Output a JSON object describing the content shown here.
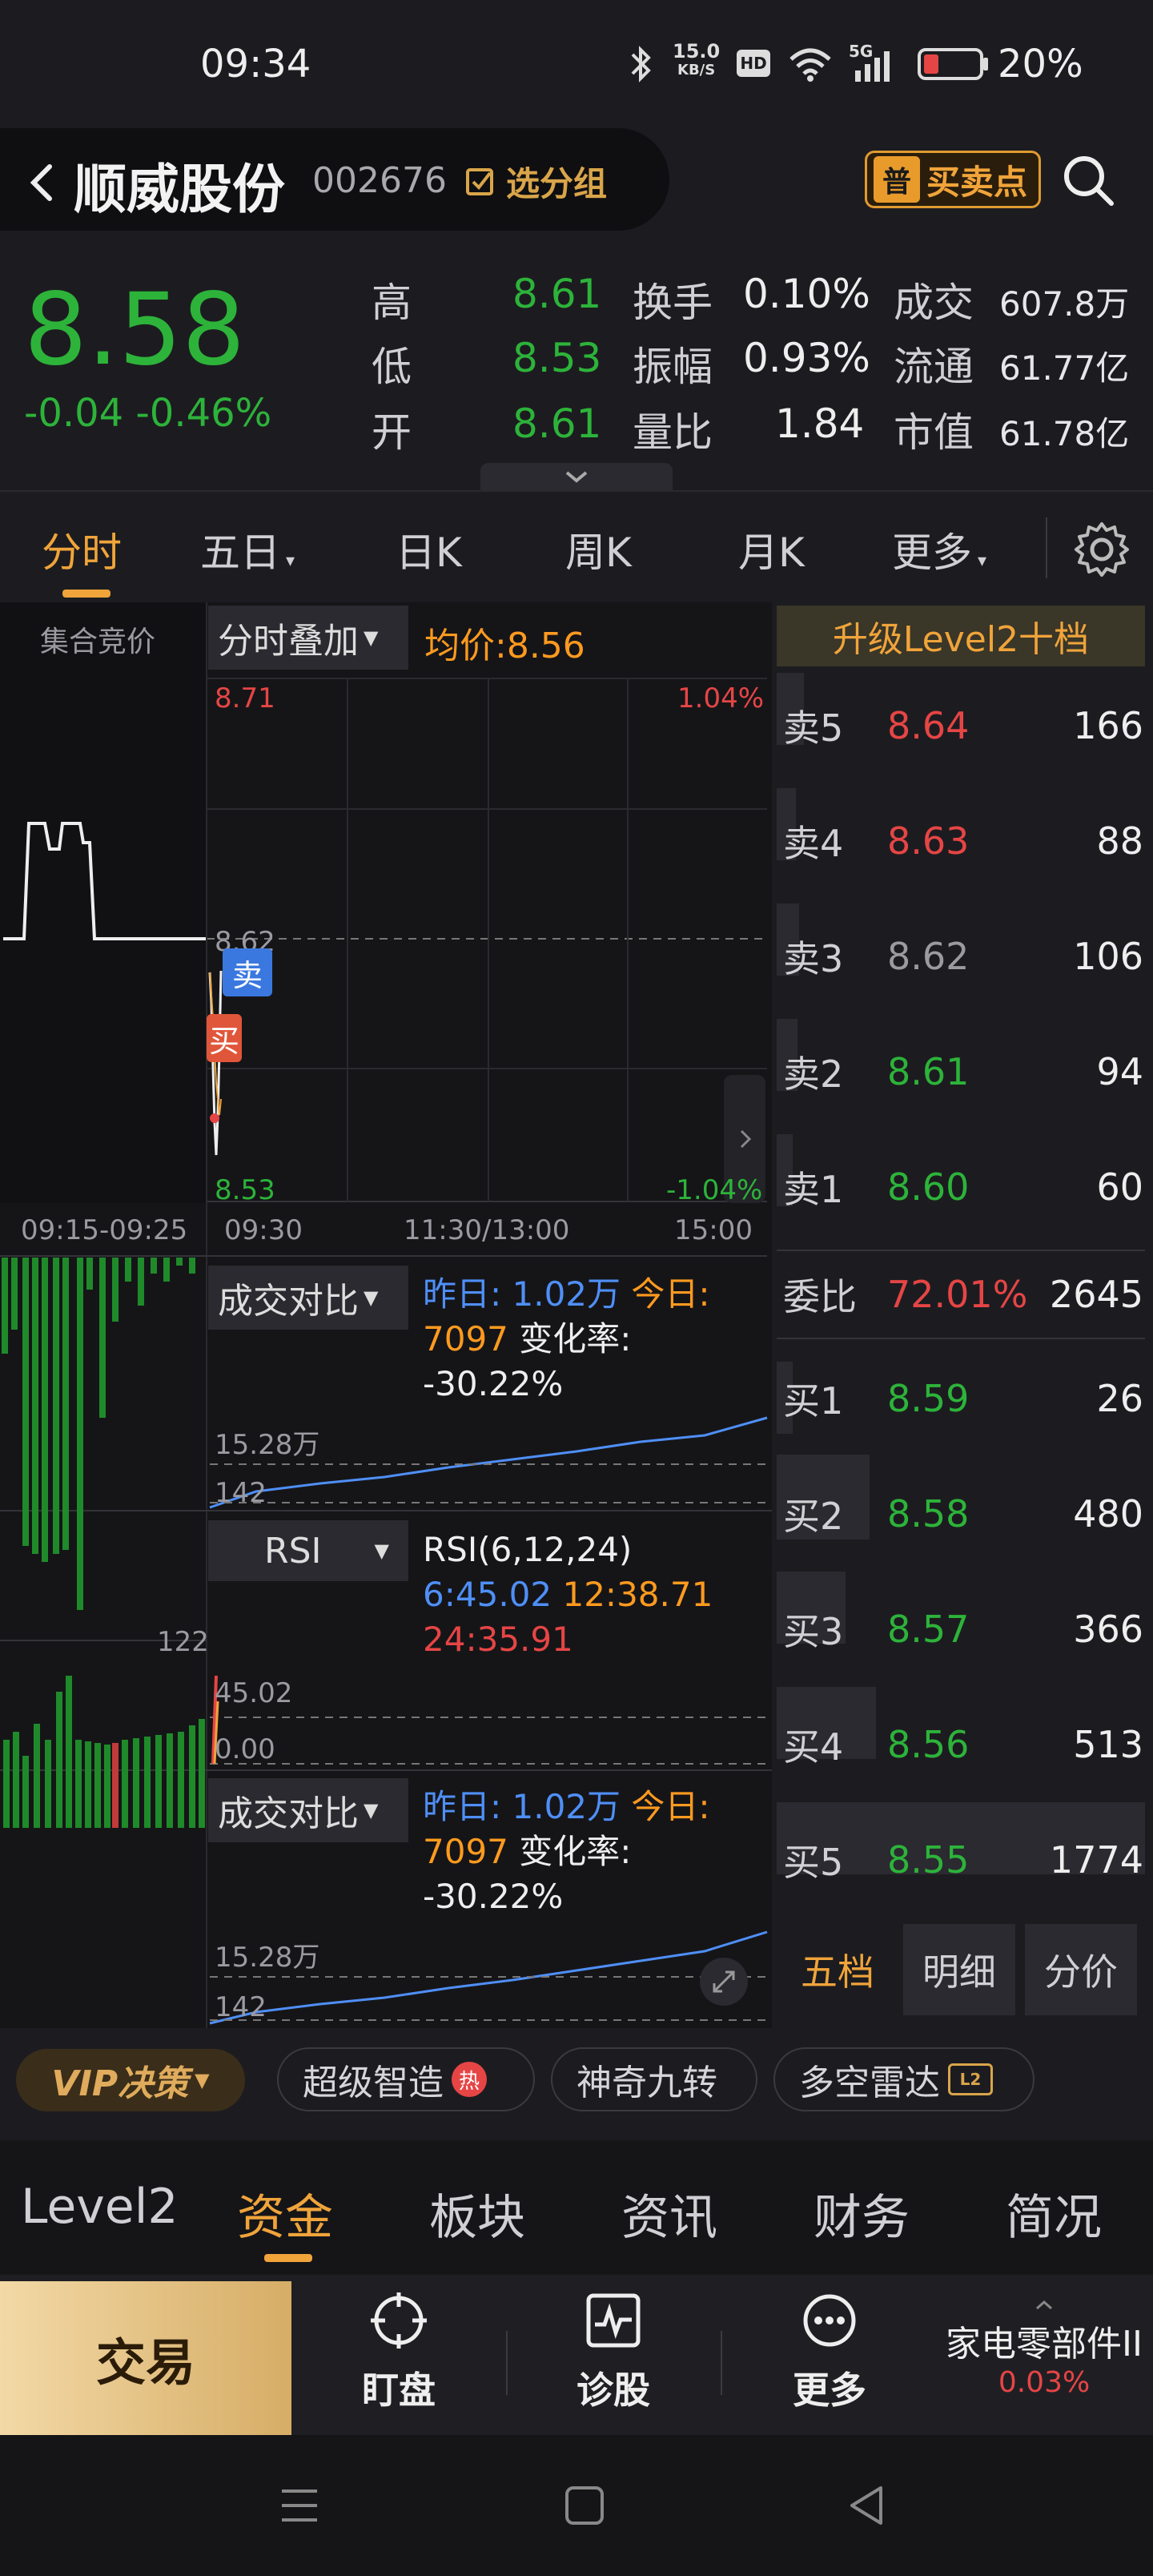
{
  "status_bar": {
    "time": "09:34",
    "net_speed": "15.0",
    "net_unit": "KB/S",
    "battery": "20%",
    "hd": "HD",
    "sig": "5G"
  },
  "header": {
    "stock_name": "顺威股份",
    "stock_code": "002676",
    "group_btn": "选分组",
    "bsp_tag": "普",
    "bsp_label": "买卖点"
  },
  "quote": {
    "price": "8.58",
    "change": "-0.04  -0.46%",
    "rows": [
      {
        "l1": "高",
        "v1": "8.61",
        "l2": "换手",
        "v2": "0.10%",
        "l3": "成交",
        "v3": "607.8万"
      },
      {
        "l1": "低",
        "v1": "8.53",
        "l2": "振幅",
        "v2": "0.93%",
        "l3": "流通",
        "v3": "61.77亿"
      },
      {
        "l1": "开",
        "v1": "8.61",
        "l2": "量比",
        "v2": "1.84",
        "l3": "市值",
        "v3": "61.78亿"
      }
    ]
  },
  "tabs": [
    "分时",
    "五日",
    "日K",
    "周K",
    "月K",
    "更多"
  ],
  "chart": {
    "auction_label": "集合竞价",
    "overlay": "分时叠加",
    "avg_price": "均价:8.56",
    "y_top": "8.71",
    "y_mid": "8.62",
    "y_bot": "8.53",
    "pct_top": "1.04%",
    "pct_bot": "-1.04%",
    "sell_tag": "卖",
    "buy_tag": "买",
    "time_auction": "09:15-09:25",
    "time_open": "09:30",
    "time_mid": "11:30/13:00",
    "time_close": "15:00",
    "vol_panel": {
      "title": "成交对比",
      "yest_label": "昨日: 1.02万",
      "today_label": "今日:",
      "today_val": "7097",
      "rate_label": "变化率:",
      "rate_val": "-30.22%",
      "y_top": "15.28万",
      "y_bot": "142"
    },
    "rsi_panel": {
      "title": "RSI",
      "params": "RSI(6,12,24)",
      "r6": "6:45.02",
      "r12": "12:38.71",
      "r24": "24:35.91",
      "y_top": "45.02",
      "y_bot": "0.00",
      "left_val": "122"
    },
    "vol_panel2": {
      "title": "成交对比",
      "yest_label": "昨日: 1.02万",
      "today_label": "今日:",
      "today_val": "7097",
      "rate_label": "变化率:",
      "rate_val": "-30.22%",
      "y_top": "15.28万",
      "y_bot": "142"
    }
  },
  "orderbook": {
    "upgrade": "升级Level2十档",
    "sells": [
      {
        "label": "卖5",
        "price": "8.64",
        "vol": "166",
        "color": "red"
      },
      {
        "label": "卖4",
        "price": "8.63",
        "vol": "88",
        "color": "red"
      },
      {
        "label": "卖3",
        "price": "8.62",
        "vol": "106",
        "color": "gray"
      },
      {
        "label": "卖2",
        "price": "8.61",
        "vol": "94",
        "color": "green"
      },
      {
        "label": "卖1",
        "price": "8.60",
        "vol": "60",
        "color": "green"
      }
    ],
    "ratio_label": "委比",
    "ratio_pct": "72.01%",
    "ratio_val": "2645",
    "buys": [
      {
        "label": "买1",
        "price": "8.59",
        "vol": "26",
        "color": "green"
      },
      {
        "label": "买2",
        "price": "8.58",
        "vol": "480",
        "color": "green"
      },
      {
        "label": "买3",
        "price": "8.57",
        "vol": "366",
        "color": "green"
      },
      {
        "label": "买4",
        "price": "8.56",
        "vol": "513",
        "color": "green"
      },
      {
        "label": "买5",
        "price": "8.55",
        "vol": "1774",
        "color": "green"
      }
    ],
    "sub_tabs": [
      "五档",
      "明细",
      "分价"
    ]
  },
  "indicators": {
    "vip": "VIP决策",
    "chips": [
      "超级智造",
      "神奇九转",
      "多空雷达"
    ],
    "hot_tag": "热",
    "radar_tag": "L2"
  },
  "bottom_tabs": [
    "Level2",
    "资金",
    "板块",
    "资讯",
    "财务",
    "简况"
  ],
  "actions": {
    "trade": "交易",
    "watch": "盯盘",
    "diagnose": "诊股",
    "more": "更多",
    "sector": "家电零部件II",
    "sector_pct": "0.03%"
  }
}
